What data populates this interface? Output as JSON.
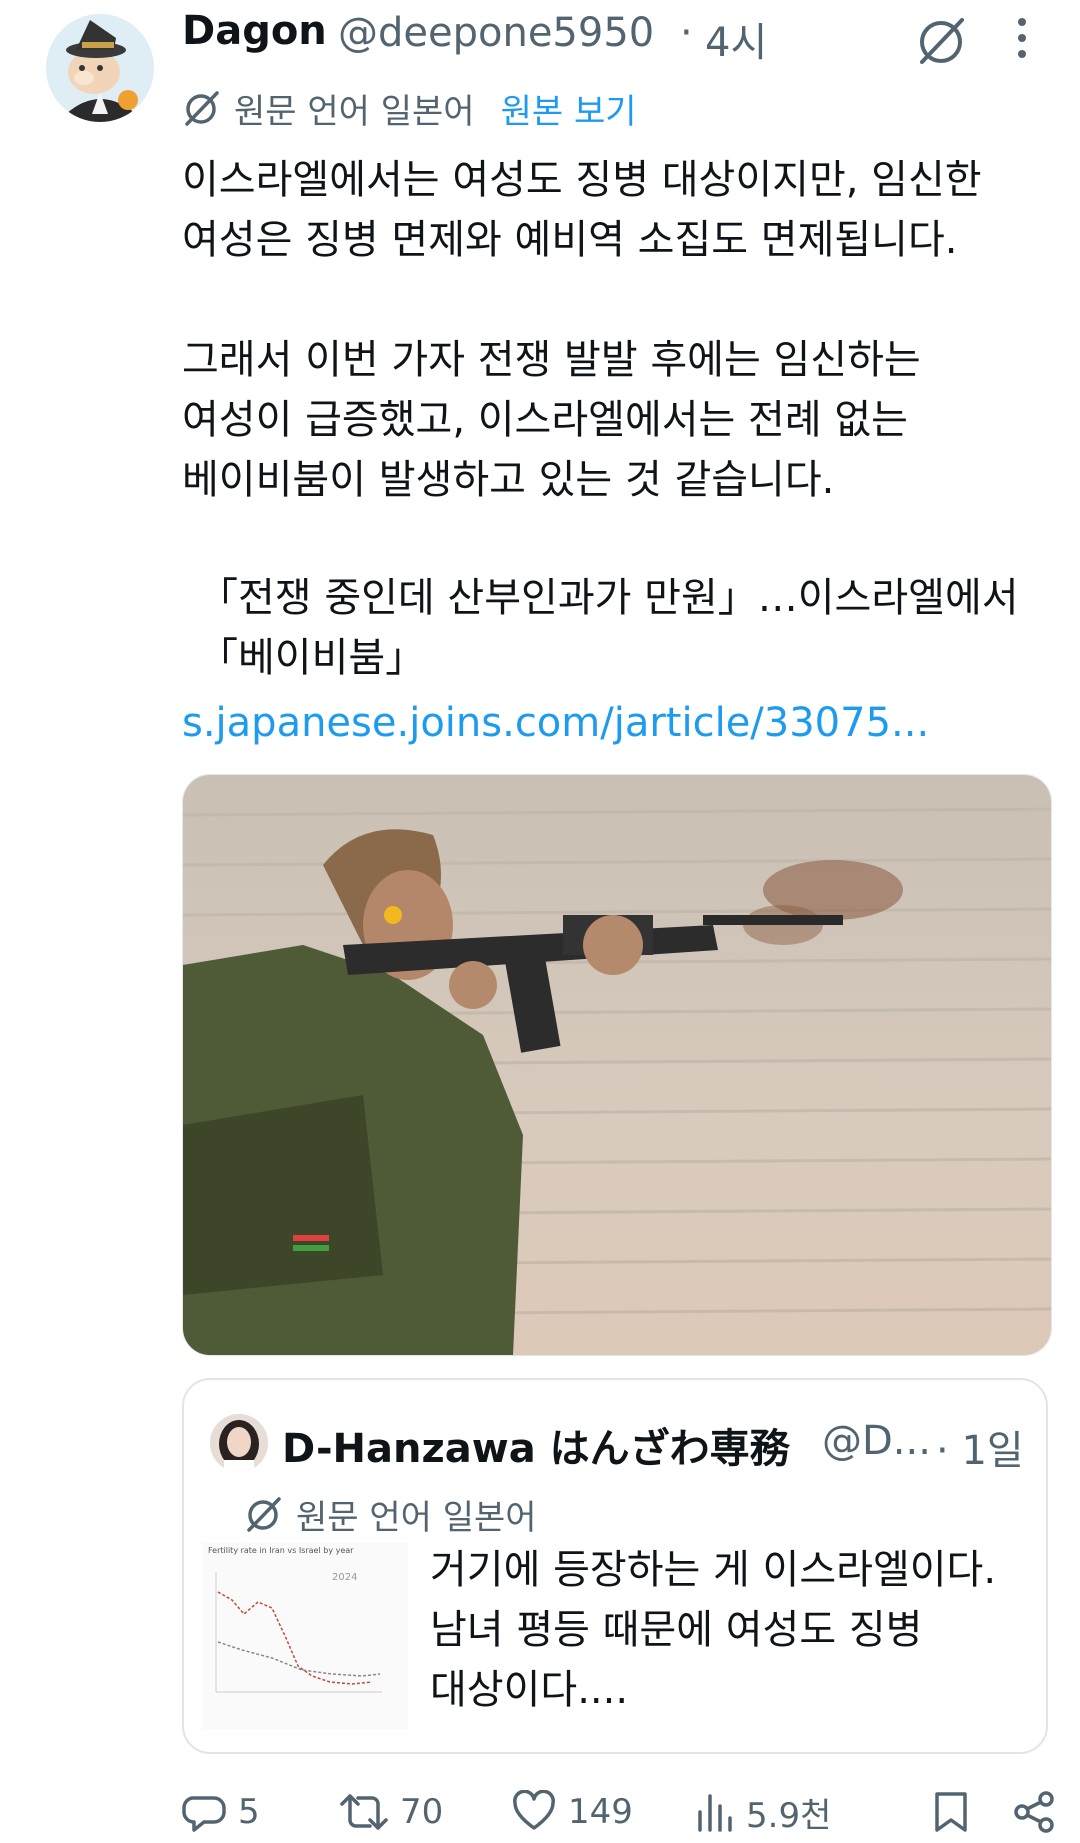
{
  "tweet": {
    "author_name": "Dagon",
    "author_handle": "@deepone5950",
    "separator": "·",
    "time": "4시",
    "original_language_text": "원문 언어 일본어",
    "view_original_link": "원본 보기",
    "body": "이스라엘에서는 여성도 징병 대상이지만, 임신한\n여성은 징병 면제와 예비역 소집도 면제됩니다.\n\n그래서 이번 가자 전쟁 발발 후에는 임신하는\n여성이 급증했고, 이스라엘에서는 전례 없는\n베이비붐이 발생하고 있는 것 같습니다.",
    "link_card_title": "「전쟁 중인데 산부인과가 만원」…이스라엘에서 「베이비붐」",
    "link_card_url": "s.japanese.joins.com/jarticle/33075..."
  },
  "quote": {
    "author_name": "D-Hanzawa はんざわ専務",
    "author_handle": "@D...",
    "separator": "·",
    "time": "1일",
    "original_language_text": "원문 언어 일본어",
    "body": "거기에 등장하는 게 이스라엘이다.\n남녀 평등 때문에 여성도 징병\n대상이다....",
    "thumbnail": {
      "title": "Fertility rate in Iran vs Israel by year",
      "year_label": "2024"
    }
  },
  "actions": {
    "replies": "5",
    "retweets": "70",
    "likes": "149",
    "views": "5.9천"
  },
  "icons": [
    "grok-icon",
    "more-icon",
    "translate-icon",
    "reply-icon",
    "retweet-icon",
    "like-icon",
    "views-icon",
    "bookmark-icon",
    "share-icon"
  ],
  "colors": {
    "link": "#1d9bf0",
    "secondary_text": "#536471",
    "primary_text": "#0f1419"
  }
}
